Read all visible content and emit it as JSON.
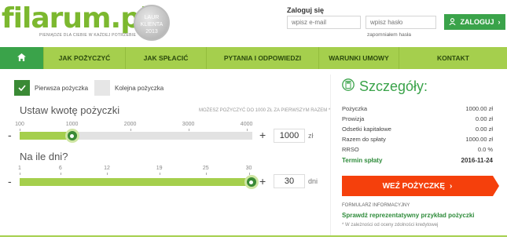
{
  "header": {
    "logo": "filarum.pl",
    "tagline": "PIENIĄDZE DLA CIEBIE W KAŻDEJ POTRZEBIE",
    "medal": {
      "line1": "LAUR",
      "line2": "KLIENTA",
      "year": "2013"
    }
  },
  "login": {
    "title": "Zaloguj się",
    "email_placeholder": "wpisz e-mail",
    "password_placeholder": "wpisz hasło",
    "forgot": "zapomniałem hasła",
    "button": "ZALOGUJ",
    "button_arrow": "›"
  },
  "nav": [
    {
      "label": "JAK POŻYCZYĆ"
    },
    {
      "label": "JAK SPŁACIĆ"
    },
    {
      "label": "PYTANIA I ODPOWIEDZI"
    },
    {
      "label": "WARUNKI UMOWY"
    },
    {
      "label": "KONTAKT"
    }
  ],
  "tabs": {
    "first": "Pierwsza pożyczka",
    "next": "Kolejna pożyczka"
  },
  "amount": {
    "title": "Ustaw kwotę pożyczki",
    "hint": "MOŻESZ POŻYCZYĆ DO 1000 ZŁ ZA PIERWSZYM RAZEM *",
    "ticks": [
      "100",
      "1000",
      "2000",
      "3000",
      "4000"
    ],
    "minus": "-",
    "plus": "+",
    "value": "1000",
    "unit": "zł",
    "fraction": 0.225
  },
  "days": {
    "title": "Na ile dni?",
    "ticks": [
      "1",
      "6",
      "12",
      "19",
      "25",
      "30"
    ],
    "minus": "-",
    "plus": "+",
    "value": "30",
    "unit": "dni",
    "fraction": 1.0
  },
  "details": {
    "title": "Szczegóły:",
    "rows": [
      {
        "label": "Pożyczka",
        "value": "1000.00 zł"
      },
      {
        "label": "Prowizja",
        "value": "0.00 zł"
      },
      {
        "label": "Odsetki kapitałowe",
        "value": "0.00 zł"
      },
      {
        "label": "Razem do spłaty",
        "value": "1000.00 zł"
      },
      {
        "label": "RRSO",
        "value": "0.0 %"
      }
    ],
    "term_label": "Termin spłaty",
    "term_value": "2016-11-24",
    "cta": "WEŹ POŻYCZKĘ",
    "cta_arrow": "›",
    "form_info": "FORMULARZ INFORMACYJNY",
    "example_link": "Sprawdź reprezentatywny przykład pożyczki",
    "footnote": "* W zależności od oceny zdolności kredytowej"
  },
  "colors": {
    "brand_green": "#7cb82f",
    "nav_green": "#a5cf4d",
    "dark_green": "#3aa34a",
    "cta_orange": "#f5400c"
  }
}
